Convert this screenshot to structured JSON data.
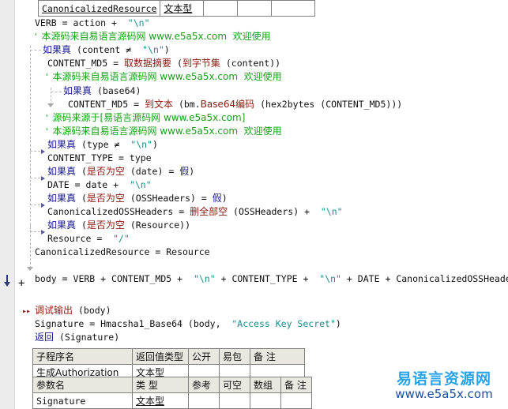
{
  "app": {
    "name": "e-language-code-editor",
    "language": "yi-yuyan"
  },
  "top_table": {
    "rows": [
      {
        "name": "CanonicalizedResource",
        "type": "文本型",
        "c3": "",
        "c4": "",
        "c5": ""
      }
    ]
  },
  "code_lines": [
    {
      "id": "l1",
      "text": "VERB = action + \"\\n\""
    },
    {
      "id": "l2",
      "text": "' 本源码来自易语言源码网 www.e5a5x.com  欢迎使用"
    },
    {
      "id": "l3",
      "text": "如果真 (content ≠ \"\\n\")"
    },
    {
      "id": "l4",
      "text": "CONTENT_MD5 = 取数据摘要 (到字节集 (content))"
    },
    {
      "id": "l5",
      "text": "' 本源码来自易语言源码网 www.e5a5x.com  欢迎使用"
    },
    {
      "id": "l6",
      "text": "如果真 (base64)"
    },
    {
      "id": "l7",
      "text": "CONTENT_MD5 = 到文本 (bm.Base64编码 (hex2bytes (CONTENT_MD5)))"
    },
    {
      "id": "l8",
      "text": "' 源码来源于[易语言源码网 www.e5a5x.com]"
    },
    {
      "id": "l9",
      "text": "' 本源码来自易语言源码网 www.e5a5x.com  欢迎使用"
    },
    {
      "id": "l10",
      "text": "如果真 (type ≠ \"\\n\")"
    },
    {
      "id": "l11",
      "text": "CONTENT_TYPE = type"
    },
    {
      "id": "l12",
      "text": "如果真 (是否为空 (date) = 假)"
    },
    {
      "id": "l13",
      "text": "DATE = date + \"\\n\""
    },
    {
      "id": "l14",
      "text": "如果真 (是否为空 (OSSHeaders) = 假)"
    },
    {
      "id": "l15",
      "text": "CanonicalizedOSSHeaders = 删全部空 (OSSHeaders) + \"\\n\""
    },
    {
      "id": "l16",
      "text": "如果真 (是否为空 (Resource))"
    },
    {
      "id": "l17",
      "text": "Resource = \"/\""
    },
    {
      "id": "l18",
      "text": "CanonicalizedResource = Resource"
    },
    {
      "id": "l19",
      "text": "body = VERB + CONTENT_MD5 + \"\\n\" + CONTENT_TYPE + \"\\n\" + DATE + CanonicalizedOSSHeaders +"
    },
    {
      "id": "l20",
      "text": "调试输出 (body)"
    },
    {
      "id": "l21",
      "text": "Signature = Hmacsha1_Base64 (body, \"Access Key Secret\")"
    },
    {
      "id": "l22",
      "text": "返回 (Signature)"
    }
  ],
  "tokens": {
    "kw_ruguozhen": "如果真",
    "kw_fanhui": "返回",
    "fn_qushujuzhaiyao": "取数据摘要",
    "fn_daoziejieji": "到字节集",
    "fn_daowenben": "到文本",
    "fn_base64bianma": "Base64编码",
    "fn_shifouweikong": "是否为空",
    "fn_shanquanbukong": "删全部空",
    "fn_tiaoshishuchu": "调试输出",
    "lit_jia": "假",
    "str_newline": "\"\\n\"",
    "str_slash": "\"/\"",
    "str_aks": "\"Access Key Secret\"",
    "id_verb": "VERB",
    "id_action": "action",
    "id_content": "content",
    "id_content_md5": "CONTENT_MD5",
    "id_base64": "base64",
    "id_bm": "bm.",
    "id_hex2bytes": "hex2bytes",
    "id_type": "type",
    "id_content_type": "CONTENT_TYPE",
    "id_date_lower": "date",
    "id_date_upper": "DATE",
    "id_ossheaders": "OSSHeaders",
    "id_canon_ossheaders": "CanonicalizedOSSHeaders",
    "id_resource": "Resource",
    "id_canon_resource": "CanonicalizedResource",
    "id_body": "body",
    "id_signature": "Signature",
    "id_hmac": "Hmacsha1_Base64",
    "op_eq": "=",
    "op_plus": "+",
    "op_neq": "≠",
    "paren_open": "(",
    "paren_close": ")"
  },
  "comments": {
    "c_main": "本源码来自易语言源码网",
    "c_main_url": "www.e5a5x.com",
    "c_main_tail": "欢迎使用",
    "c_src": "源码来源于[易语言源码网",
    "c_src_url": "www.e5a5x.com",
    "c_src_tail": "]",
    "quote": "'"
  },
  "gutter": {
    "fold_plus": "+",
    "double_arrow": "▸▸"
  },
  "bottom_table": {
    "header_sub": [
      "子程序名",
      "返回值类型",
      "公开",
      "易包",
      "备 注"
    ],
    "row_sub": [
      "生成Authorization",
      "文本型",
      "",
      "",
      ""
    ],
    "header_param": [
      "参数名",
      "类 型",
      "参考",
      "可空",
      "数组",
      "备 注"
    ],
    "row_param": [
      "Signature",
      "文本型",
      "",
      "",
      "",
      ""
    ]
  },
  "watermark": {
    "line1": "易语言资源网",
    "line2": "www.e5a5x.com"
  },
  "colors": {
    "keyword": "#1a1a8c",
    "function": "#8b1a10",
    "string": "#1a8c8c",
    "comment": "#18a018",
    "identifier": "#101010",
    "gutter_bg": "#ececec",
    "table_header_bg": "#e8e8e0",
    "watermark_blue": "#2aa3e8",
    "watermark_dark": "#1a4fa0"
  }
}
